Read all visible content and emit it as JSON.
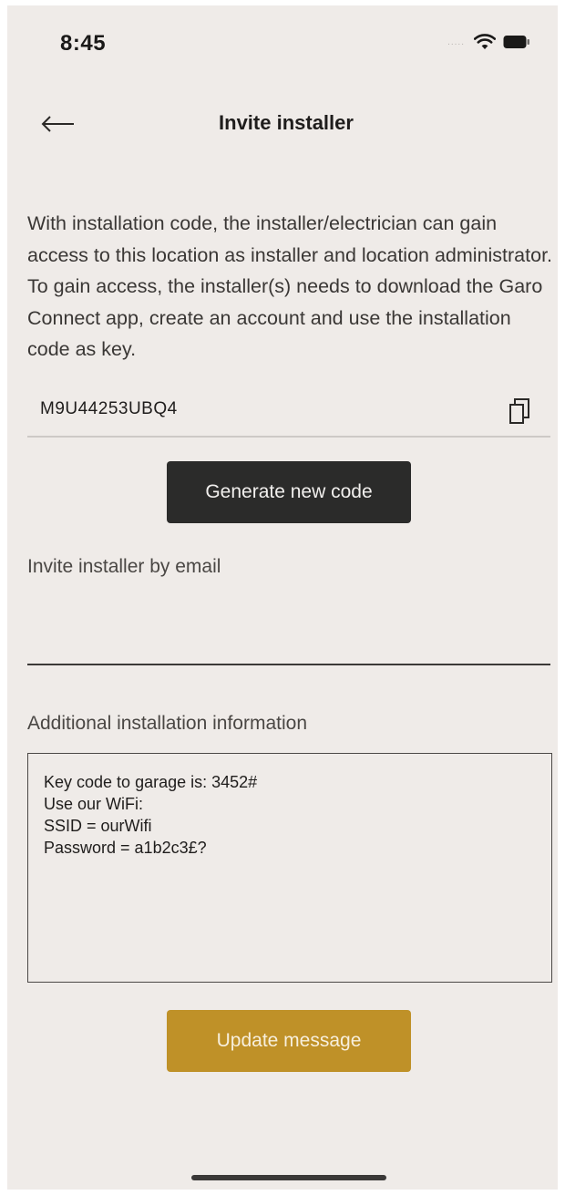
{
  "status_bar": {
    "time": "8:45",
    "signal_icon": "signal-dots-icon",
    "wifi_icon": "wifi-icon",
    "battery_icon": "battery-icon",
    "signal_text": "....."
  },
  "header": {
    "title": "Invite installer",
    "back_icon": "arrow-left-icon"
  },
  "description": "With installation code, the installer/electrician can gain access to this location as installer and location administrator. To gain access, the installer(s) needs to download the Garo Connect app, create an account and use the installation code as key.",
  "installation_code": {
    "value": "M9U44253UBQ4",
    "copy_icon": "copy-icon"
  },
  "generate_button": {
    "label": "Generate new code"
  },
  "email": {
    "label": "Invite installer by email",
    "value": ""
  },
  "additional_info": {
    "label": "Additional installation information",
    "lines": [
      "Key code to garage is: 3452#",
      "Use our WiFi:",
      "SSID = ourWifi",
      "Password = a1b2c3£?"
    ]
  },
  "update_button": {
    "label": "Update message"
  },
  "colors": {
    "background": "#efebe8",
    "dark_button": "#2b2b2a",
    "accent_gold": "#bf9128",
    "text": "#2b2927"
  }
}
